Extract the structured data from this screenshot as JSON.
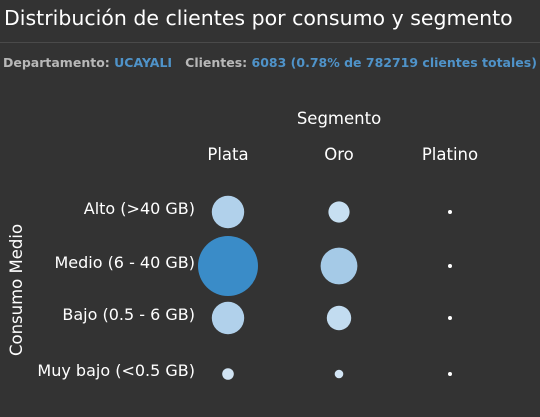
{
  "header": {
    "title": "Distribución de clientes por consumo y segmento",
    "department_label": "Departamento:",
    "department_value": "UCAYALI",
    "clients_label": "Clientes:",
    "clients_value": "6083 (0.78% de 782719 clientes totales)"
  },
  "colors": {
    "background": "#333333",
    "bubble_light": "#d4e6f5",
    "bubble_dark": "#3a8cc8",
    "accent_text": "#4f93c9"
  },
  "chart_data": {
    "type": "bubble",
    "xlabel": "Segmento",
    "ylabel": "Consumo Medio",
    "categories": [
      "Plata",
      "Oro",
      "Platino"
    ],
    "rows": [
      "Alto (>40 GB)",
      "Medio (6 - 40 GB)",
      "Bajo (0.5 - 6 GB)",
      "Muy bajo (<0.5 GB)"
    ],
    "values": [
      [
        700,
        300,
        5
      ],
      [
        2400,
        900,
        10
      ],
      [
        700,
        400,
        10
      ],
      [
        90,
        50,
        2
      ]
    ],
    "legend": "none",
    "grid": false
  }
}
